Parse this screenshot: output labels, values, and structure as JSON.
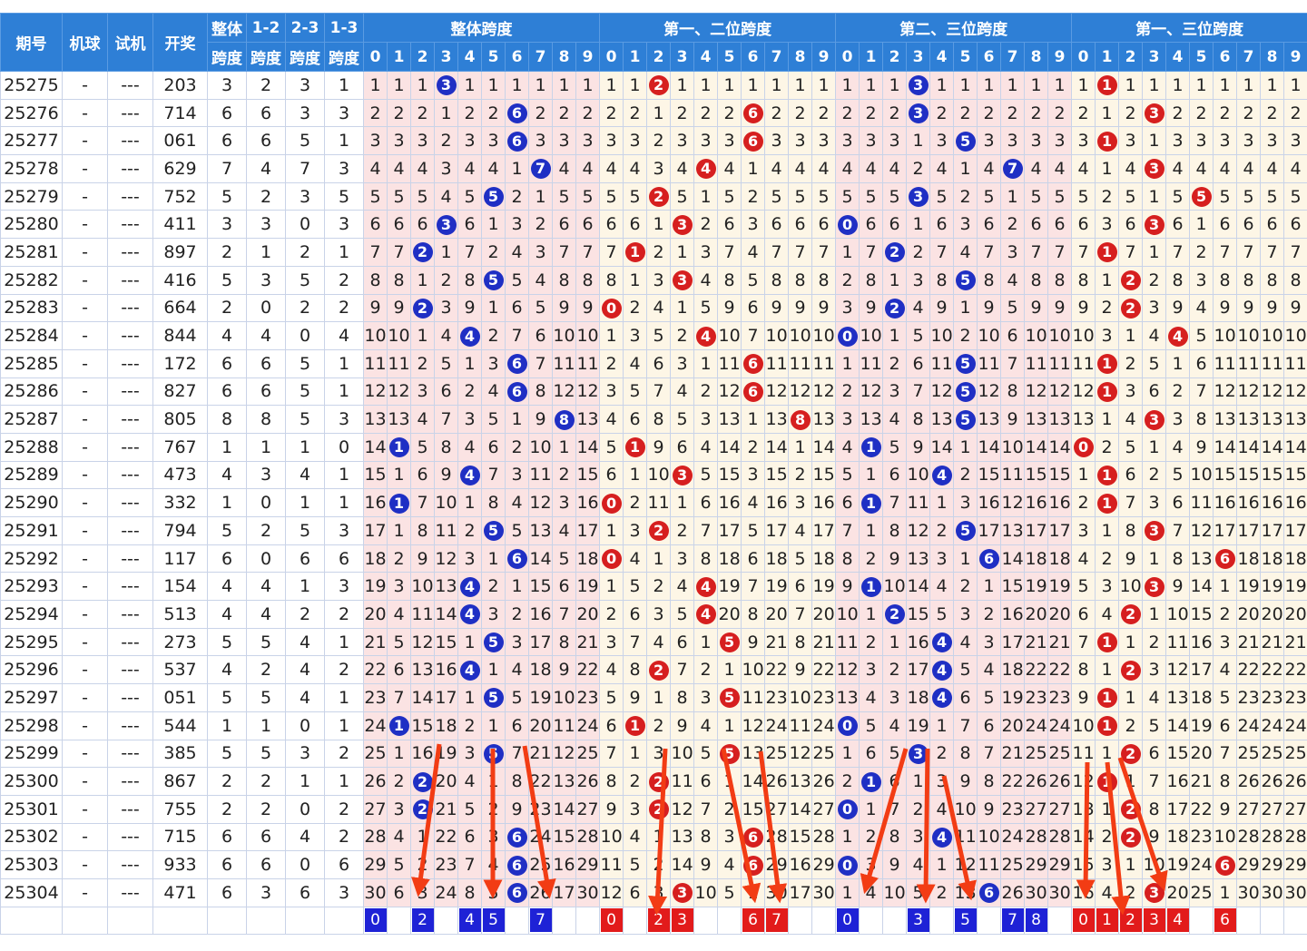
{
  "header": {
    "issue": "期号",
    "machine": "机球",
    "test": "试机",
    "draw": "开奖",
    "overall_top": "整体",
    "overall_bottom": "跨度",
    "s12_top": "1-2",
    "s23_top": "2-3",
    "s13_top": "1-3",
    "span_bottom": "跨度",
    "groups": [
      "整体跨度",
      "第一、二位跨度",
      "第二、三位跨度",
      "第一、三位跨度"
    ],
    "digits": [
      "0",
      "1",
      "2",
      "3",
      "4",
      "5",
      "6",
      "7",
      "8",
      "9"
    ]
  },
  "colors": {
    "header_bg": "#2e7fd6",
    "blue_ball": "#1f2fc4",
    "red_ball": "#d61f1f",
    "arrow": "#f23c14"
  },
  "chart_data": {
    "type": "table",
    "columns": [
      "期号",
      "机球",
      "试机",
      "开奖",
      "整体跨度",
      "1-2跨度",
      "2-3跨度",
      "1-3跨度"
    ],
    "rows": [
      [
        "25275",
        "-",
        "---",
        "203",
        "3",
        "2",
        "3",
        "1"
      ],
      [
        "25276",
        "-",
        "---",
        "714",
        "6",
        "6",
        "3",
        "3"
      ],
      [
        "25277",
        "-",
        "---",
        "061",
        "6",
        "6",
        "5",
        "1"
      ],
      [
        "25278",
        "-",
        "---",
        "629",
        "7",
        "4",
        "7",
        "3"
      ],
      [
        "25279",
        "-",
        "---",
        "752",
        "5",
        "2",
        "3",
        "5"
      ],
      [
        "25280",
        "-",
        "---",
        "411",
        "3",
        "3",
        "0",
        "3"
      ],
      [
        "25281",
        "-",
        "---",
        "897",
        "2",
        "1",
        "2",
        "1"
      ],
      [
        "25282",
        "-",
        "---",
        "416",
        "5",
        "3",
        "5",
        "2"
      ],
      [
        "25283",
        "-",
        "---",
        "664",
        "2",
        "0",
        "2",
        "2"
      ],
      [
        "25284",
        "-",
        "---",
        "844",
        "4",
        "4",
        "0",
        "4"
      ],
      [
        "25285",
        "-",
        "---",
        "172",
        "6",
        "6",
        "5",
        "1"
      ],
      [
        "25286",
        "-",
        "---",
        "827",
        "6",
        "6",
        "5",
        "1"
      ],
      [
        "25287",
        "-",
        "---",
        "805",
        "8",
        "8",
        "5",
        "3"
      ],
      [
        "25288",
        "-",
        "---",
        "767",
        "1",
        "1",
        "1",
        "0"
      ],
      [
        "25289",
        "-",
        "---",
        "473",
        "4",
        "3",
        "4",
        "1"
      ],
      [
        "25290",
        "-",
        "---",
        "332",
        "1",
        "0",
        "1",
        "1"
      ],
      [
        "25291",
        "-",
        "---",
        "794",
        "5",
        "2",
        "5",
        "3"
      ],
      [
        "25292",
        "-",
        "---",
        "117",
        "6",
        "0",
        "6",
        "6"
      ],
      [
        "25293",
        "-",
        "---",
        "154",
        "4",
        "4",
        "1",
        "3"
      ],
      [
        "25294",
        "-",
        "---",
        "513",
        "4",
        "4",
        "2",
        "2"
      ],
      [
        "25295",
        "-",
        "---",
        "273",
        "5",
        "5",
        "4",
        "1"
      ],
      [
        "25296",
        "-",
        "---",
        "537",
        "4",
        "2",
        "4",
        "2"
      ],
      [
        "25297",
        "-",
        "---",
        "051",
        "5",
        "5",
        "4",
        "1"
      ],
      [
        "25298",
        "-",
        "---",
        "544",
        "1",
        "1",
        "0",
        "1"
      ],
      [
        "25299",
        "-",
        "---",
        "385",
        "5",
        "5",
        "3",
        "2"
      ],
      [
        "25300",
        "-",
        "---",
        "867",
        "2",
        "2",
        "1",
        "1"
      ],
      [
        "25301",
        "-",
        "---",
        "755",
        "2",
        "2",
        "0",
        "2"
      ],
      [
        "25302",
        "-",
        "---",
        "715",
        "6",
        "6",
        "4",
        "2"
      ],
      [
        "25303",
        "-",
        "---",
        "933",
        "6",
        "6",
        "0",
        "6"
      ],
      [
        "25304",
        "-",
        "---",
        "471",
        "6",
        "3",
        "6",
        "3"
      ]
    ],
    "footer_marks": [
      [
        "0",
        "",
        "2",
        "",
        "4",
        "5",
        "",
        "7",
        "",
        ""
      ],
      [
        "0",
        "",
        "2",
        "3",
        "",
        "",
        "6",
        "7",
        "",
        ""
      ],
      [
        "0",
        "",
        "",
        "3",
        "",
        "5",
        "",
        "7",
        "8",
        ""
      ],
      [
        "0",
        "1",
        "2",
        "3",
        "4",
        "",
        "6",
        "",
        "",
        ""
      ]
    ]
  }
}
